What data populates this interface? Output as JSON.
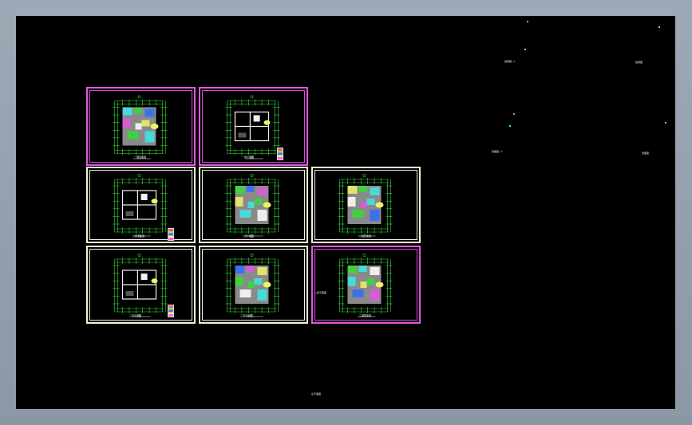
{
  "window": {
    "background": "#000000",
    "frame": "#8b97a5"
  },
  "drawing": {
    "bottom_label": "总平面图",
    "side_label": "二层平面图",
    "right_labels": [
      {
        "id": "rl1",
        "text": "轴测图—1"
      },
      {
        "id": "rl2",
        "text": "轴测图"
      },
      {
        "id": "rl3",
        "text": "剖面图—1"
      },
      {
        "id": "rl4",
        "text": "剖面图"
      }
    ],
    "sheets": [
      {
        "id": "s1",
        "caption": "一层平面图"
      },
      {
        "id": "s2",
        "caption": "一层平面图"
      },
      {
        "id": "s3",
        "caption": "二层平面图"
      },
      {
        "id": "s4",
        "caption": "二层平面图"
      },
      {
        "id": "s5",
        "caption": "二层平面图"
      },
      {
        "id": "s6",
        "caption": "三层平面图"
      },
      {
        "id": "s7",
        "caption": "三层平面图"
      },
      {
        "id": "s8",
        "caption": "三层平面图"
      }
    ]
  },
  "colors": {
    "green": "#36d936",
    "cyan": "#3ee6e6",
    "white": "#f0f0f0",
    "gray": "#8a8a8a",
    "yellow": "#f2f261",
    "blue": "#2e6cff",
    "magenta": "#e056e0"
  }
}
